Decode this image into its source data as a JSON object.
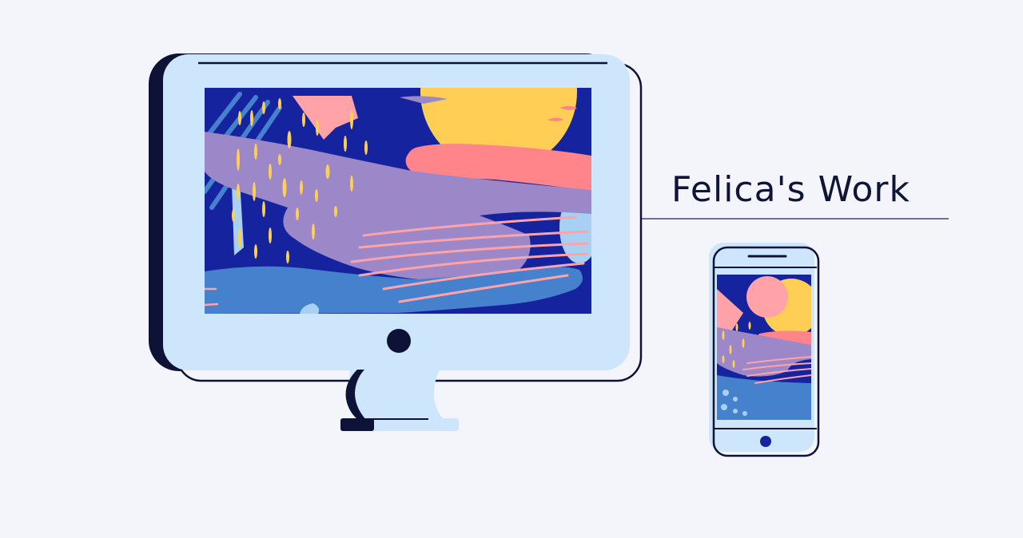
{
  "title": {
    "text": "Felica's Work"
  },
  "colors": {
    "background": "#f4f5fb",
    "device_fill": "#cde6fb",
    "outline": "#0d1236",
    "screen_bg": "#16239e",
    "yellow": "#ffcf55",
    "pink": "#ffa3a8",
    "coral": "#ff858a",
    "lavender": "#9c88c8",
    "mid_blue": "#4581cc",
    "light_blue": "#a8d0f3",
    "title_rule": "#3b3f94"
  }
}
